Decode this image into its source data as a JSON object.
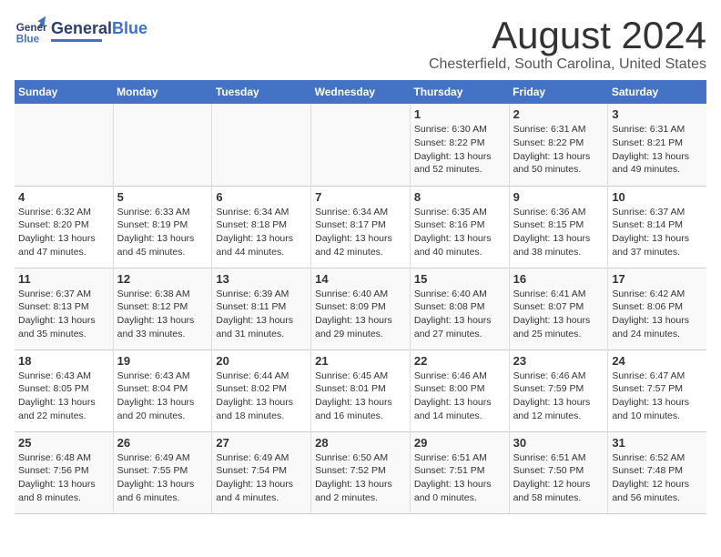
{
  "header": {
    "logo_general": "General",
    "logo_blue": "Blue",
    "title": "August 2024",
    "subtitle": "Chesterfield, South Carolina, United States"
  },
  "days_of_week": [
    "Sunday",
    "Monday",
    "Tuesday",
    "Wednesday",
    "Thursday",
    "Friday",
    "Saturday"
  ],
  "weeks": [
    {
      "days": [
        {
          "num": "",
          "info": ""
        },
        {
          "num": "",
          "info": ""
        },
        {
          "num": "",
          "info": ""
        },
        {
          "num": "",
          "info": ""
        },
        {
          "num": "1",
          "info": "Sunrise: 6:30 AM\nSunset: 8:22 PM\nDaylight: 13 hours\nand 52 minutes."
        },
        {
          "num": "2",
          "info": "Sunrise: 6:31 AM\nSunset: 8:22 PM\nDaylight: 13 hours\nand 50 minutes."
        },
        {
          "num": "3",
          "info": "Sunrise: 6:31 AM\nSunset: 8:21 PM\nDaylight: 13 hours\nand 49 minutes."
        }
      ]
    },
    {
      "days": [
        {
          "num": "4",
          "info": "Sunrise: 6:32 AM\nSunset: 8:20 PM\nDaylight: 13 hours\nand 47 minutes."
        },
        {
          "num": "5",
          "info": "Sunrise: 6:33 AM\nSunset: 8:19 PM\nDaylight: 13 hours\nand 45 minutes."
        },
        {
          "num": "6",
          "info": "Sunrise: 6:34 AM\nSunset: 8:18 PM\nDaylight: 13 hours\nand 44 minutes."
        },
        {
          "num": "7",
          "info": "Sunrise: 6:34 AM\nSunset: 8:17 PM\nDaylight: 13 hours\nand 42 minutes."
        },
        {
          "num": "8",
          "info": "Sunrise: 6:35 AM\nSunset: 8:16 PM\nDaylight: 13 hours\nand 40 minutes."
        },
        {
          "num": "9",
          "info": "Sunrise: 6:36 AM\nSunset: 8:15 PM\nDaylight: 13 hours\nand 38 minutes."
        },
        {
          "num": "10",
          "info": "Sunrise: 6:37 AM\nSunset: 8:14 PM\nDaylight: 13 hours\nand 37 minutes."
        }
      ]
    },
    {
      "days": [
        {
          "num": "11",
          "info": "Sunrise: 6:37 AM\nSunset: 8:13 PM\nDaylight: 13 hours\nand 35 minutes."
        },
        {
          "num": "12",
          "info": "Sunrise: 6:38 AM\nSunset: 8:12 PM\nDaylight: 13 hours\nand 33 minutes."
        },
        {
          "num": "13",
          "info": "Sunrise: 6:39 AM\nSunset: 8:11 PM\nDaylight: 13 hours\nand 31 minutes."
        },
        {
          "num": "14",
          "info": "Sunrise: 6:40 AM\nSunset: 8:09 PM\nDaylight: 13 hours\nand 29 minutes."
        },
        {
          "num": "15",
          "info": "Sunrise: 6:40 AM\nSunset: 8:08 PM\nDaylight: 13 hours\nand 27 minutes."
        },
        {
          "num": "16",
          "info": "Sunrise: 6:41 AM\nSunset: 8:07 PM\nDaylight: 13 hours\nand 25 minutes."
        },
        {
          "num": "17",
          "info": "Sunrise: 6:42 AM\nSunset: 8:06 PM\nDaylight: 13 hours\nand 24 minutes."
        }
      ]
    },
    {
      "days": [
        {
          "num": "18",
          "info": "Sunrise: 6:43 AM\nSunset: 8:05 PM\nDaylight: 13 hours\nand 22 minutes."
        },
        {
          "num": "19",
          "info": "Sunrise: 6:43 AM\nSunset: 8:04 PM\nDaylight: 13 hours\nand 20 minutes."
        },
        {
          "num": "20",
          "info": "Sunrise: 6:44 AM\nSunset: 8:02 PM\nDaylight: 13 hours\nand 18 minutes."
        },
        {
          "num": "21",
          "info": "Sunrise: 6:45 AM\nSunset: 8:01 PM\nDaylight: 13 hours\nand 16 minutes."
        },
        {
          "num": "22",
          "info": "Sunrise: 6:46 AM\nSunset: 8:00 PM\nDaylight: 13 hours\nand 14 minutes."
        },
        {
          "num": "23",
          "info": "Sunrise: 6:46 AM\nSunset: 7:59 PM\nDaylight: 13 hours\nand 12 minutes."
        },
        {
          "num": "24",
          "info": "Sunrise: 6:47 AM\nSunset: 7:57 PM\nDaylight: 13 hours\nand 10 minutes."
        }
      ]
    },
    {
      "days": [
        {
          "num": "25",
          "info": "Sunrise: 6:48 AM\nSunset: 7:56 PM\nDaylight: 13 hours\nand 8 minutes."
        },
        {
          "num": "26",
          "info": "Sunrise: 6:49 AM\nSunset: 7:55 PM\nDaylight: 13 hours\nand 6 minutes."
        },
        {
          "num": "27",
          "info": "Sunrise: 6:49 AM\nSunset: 7:54 PM\nDaylight: 13 hours\nand 4 minutes."
        },
        {
          "num": "28",
          "info": "Sunrise: 6:50 AM\nSunset: 7:52 PM\nDaylight: 13 hours\nand 2 minutes."
        },
        {
          "num": "29",
          "info": "Sunrise: 6:51 AM\nSunset: 7:51 PM\nDaylight: 13 hours\nand 0 minutes."
        },
        {
          "num": "30",
          "info": "Sunrise: 6:51 AM\nSunset: 7:50 PM\nDaylight: 12 hours\nand 58 minutes."
        },
        {
          "num": "31",
          "info": "Sunrise: 6:52 AM\nSunset: 7:48 PM\nDaylight: 12 hours\nand 56 minutes."
        }
      ]
    }
  ]
}
